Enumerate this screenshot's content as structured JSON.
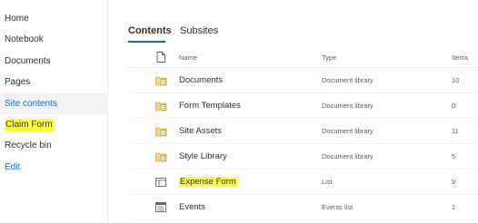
{
  "nav": {
    "items": [
      {
        "label": "Home"
      },
      {
        "label": "Notebook"
      },
      {
        "label": "Documents"
      },
      {
        "label": "Pages"
      },
      {
        "label": "Site contents"
      },
      {
        "label": "Claim Form"
      },
      {
        "label": "Recycle bin"
      },
      {
        "label": "Edit"
      }
    ]
  },
  "tabs": [
    {
      "label": "Contents"
    },
    {
      "label": "Subsites"
    }
  ],
  "table": {
    "headers": {
      "name": "Name",
      "type": "Type",
      "items": "Items"
    },
    "rows": [
      {
        "name": "Documents",
        "type": "Document library",
        "items": "10",
        "icon": "document-library-icon"
      },
      {
        "name": "Form Templates",
        "type": "Document library",
        "items": "0",
        "icon": "document-library-icon"
      },
      {
        "name": "Site Assets",
        "type": "Document library",
        "items": "11",
        "icon": "document-library-icon"
      },
      {
        "name": "Style Library",
        "type": "Document library",
        "items": "5",
        "icon": "document-library-icon"
      },
      {
        "name": "Expense Form",
        "type": "List",
        "items": "9",
        "icon": "list-icon"
      },
      {
        "name": "Events",
        "type": "Events list",
        "items": "1",
        "icon": "events-list-icon"
      }
    ]
  },
  "colors": {
    "accent": "#0f6cbd",
    "link": "#1b6ec2",
    "highlight": "#ffff3a",
    "selected_bg": "#f3f2f1"
  }
}
